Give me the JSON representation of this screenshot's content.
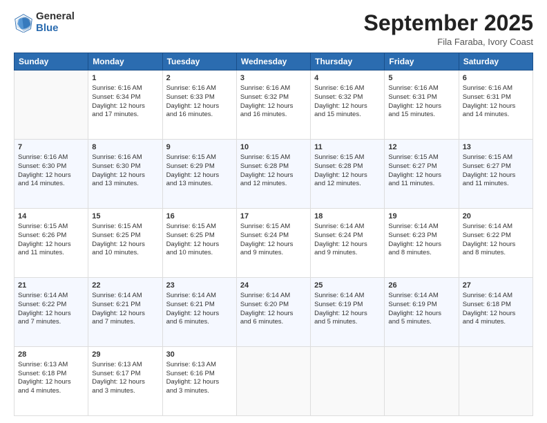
{
  "logo": {
    "general": "General",
    "blue": "Blue"
  },
  "header": {
    "month": "September 2025",
    "location": "Fila Faraba, Ivory Coast"
  },
  "days": [
    "Sunday",
    "Monday",
    "Tuesday",
    "Wednesday",
    "Thursday",
    "Friday",
    "Saturday"
  ],
  "weeks": [
    [
      {
        "num": "",
        "lines": []
      },
      {
        "num": "1",
        "lines": [
          "Sunrise: 6:16 AM",
          "Sunset: 6:34 PM",
          "Daylight: 12 hours",
          "and 17 minutes."
        ]
      },
      {
        "num": "2",
        "lines": [
          "Sunrise: 6:16 AM",
          "Sunset: 6:33 PM",
          "Daylight: 12 hours",
          "and 16 minutes."
        ]
      },
      {
        "num": "3",
        "lines": [
          "Sunrise: 6:16 AM",
          "Sunset: 6:32 PM",
          "Daylight: 12 hours",
          "and 16 minutes."
        ]
      },
      {
        "num": "4",
        "lines": [
          "Sunrise: 6:16 AM",
          "Sunset: 6:32 PM",
          "Daylight: 12 hours",
          "and 15 minutes."
        ]
      },
      {
        "num": "5",
        "lines": [
          "Sunrise: 6:16 AM",
          "Sunset: 6:31 PM",
          "Daylight: 12 hours",
          "and 15 minutes."
        ]
      },
      {
        "num": "6",
        "lines": [
          "Sunrise: 6:16 AM",
          "Sunset: 6:31 PM",
          "Daylight: 12 hours",
          "and 14 minutes."
        ]
      }
    ],
    [
      {
        "num": "7",
        "lines": [
          "Sunrise: 6:16 AM",
          "Sunset: 6:30 PM",
          "Daylight: 12 hours",
          "and 14 minutes."
        ]
      },
      {
        "num": "8",
        "lines": [
          "Sunrise: 6:16 AM",
          "Sunset: 6:30 PM",
          "Daylight: 12 hours",
          "and 13 minutes."
        ]
      },
      {
        "num": "9",
        "lines": [
          "Sunrise: 6:15 AM",
          "Sunset: 6:29 PM",
          "Daylight: 12 hours",
          "and 13 minutes."
        ]
      },
      {
        "num": "10",
        "lines": [
          "Sunrise: 6:15 AM",
          "Sunset: 6:28 PM",
          "Daylight: 12 hours",
          "and 12 minutes."
        ]
      },
      {
        "num": "11",
        "lines": [
          "Sunrise: 6:15 AM",
          "Sunset: 6:28 PM",
          "Daylight: 12 hours",
          "and 12 minutes."
        ]
      },
      {
        "num": "12",
        "lines": [
          "Sunrise: 6:15 AM",
          "Sunset: 6:27 PM",
          "Daylight: 12 hours",
          "and 11 minutes."
        ]
      },
      {
        "num": "13",
        "lines": [
          "Sunrise: 6:15 AM",
          "Sunset: 6:27 PM",
          "Daylight: 12 hours",
          "and 11 minutes."
        ]
      }
    ],
    [
      {
        "num": "14",
        "lines": [
          "Sunrise: 6:15 AM",
          "Sunset: 6:26 PM",
          "Daylight: 12 hours",
          "and 11 minutes."
        ]
      },
      {
        "num": "15",
        "lines": [
          "Sunrise: 6:15 AM",
          "Sunset: 6:25 PM",
          "Daylight: 12 hours",
          "and 10 minutes."
        ]
      },
      {
        "num": "16",
        "lines": [
          "Sunrise: 6:15 AM",
          "Sunset: 6:25 PM",
          "Daylight: 12 hours",
          "and 10 minutes."
        ]
      },
      {
        "num": "17",
        "lines": [
          "Sunrise: 6:15 AM",
          "Sunset: 6:24 PM",
          "Daylight: 12 hours",
          "and 9 minutes."
        ]
      },
      {
        "num": "18",
        "lines": [
          "Sunrise: 6:14 AM",
          "Sunset: 6:24 PM",
          "Daylight: 12 hours",
          "and 9 minutes."
        ]
      },
      {
        "num": "19",
        "lines": [
          "Sunrise: 6:14 AM",
          "Sunset: 6:23 PM",
          "Daylight: 12 hours",
          "and 8 minutes."
        ]
      },
      {
        "num": "20",
        "lines": [
          "Sunrise: 6:14 AM",
          "Sunset: 6:22 PM",
          "Daylight: 12 hours",
          "and 8 minutes."
        ]
      }
    ],
    [
      {
        "num": "21",
        "lines": [
          "Sunrise: 6:14 AM",
          "Sunset: 6:22 PM",
          "Daylight: 12 hours",
          "and 7 minutes."
        ]
      },
      {
        "num": "22",
        "lines": [
          "Sunrise: 6:14 AM",
          "Sunset: 6:21 PM",
          "Daylight: 12 hours",
          "and 7 minutes."
        ]
      },
      {
        "num": "23",
        "lines": [
          "Sunrise: 6:14 AM",
          "Sunset: 6:21 PM",
          "Daylight: 12 hours",
          "and 6 minutes."
        ]
      },
      {
        "num": "24",
        "lines": [
          "Sunrise: 6:14 AM",
          "Sunset: 6:20 PM",
          "Daylight: 12 hours",
          "and 6 minutes."
        ]
      },
      {
        "num": "25",
        "lines": [
          "Sunrise: 6:14 AM",
          "Sunset: 6:19 PM",
          "Daylight: 12 hours",
          "and 5 minutes."
        ]
      },
      {
        "num": "26",
        "lines": [
          "Sunrise: 6:14 AM",
          "Sunset: 6:19 PM",
          "Daylight: 12 hours",
          "and 5 minutes."
        ]
      },
      {
        "num": "27",
        "lines": [
          "Sunrise: 6:14 AM",
          "Sunset: 6:18 PM",
          "Daylight: 12 hours",
          "and 4 minutes."
        ]
      }
    ],
    [
      {
        "num": "28",
        "lines": [
          "Sunrise: 6:13 AM",
          "Sunset: 6:18 PM",
          "Daylight: 12 hours",
          "and 4 minutes."
        ]
      },
      {
        "num": "29",
        "lines": [
          "Sunrise: 6:13 AM",
          "Sunset: 6:17 PM",
          "Daylight: 12 hours",
          "and 3 minutes."
        ]
      },
      {
        "num": "30",
        "lines": [
          "Sunrise: 6:13 AM",
          "Sunset: 6:16 PM",
          "Daylight: 12 hours",
          "and 3 minutes."
        ]
      },
      {
        "num": "",
        "lines": []
      },
      {
        "num": "",
        "lines": []
      },
      {
        "num": "",
        "lines": []
      },
      {
        "num": "",
        "lines": []
      }
    ]
  ]
}
